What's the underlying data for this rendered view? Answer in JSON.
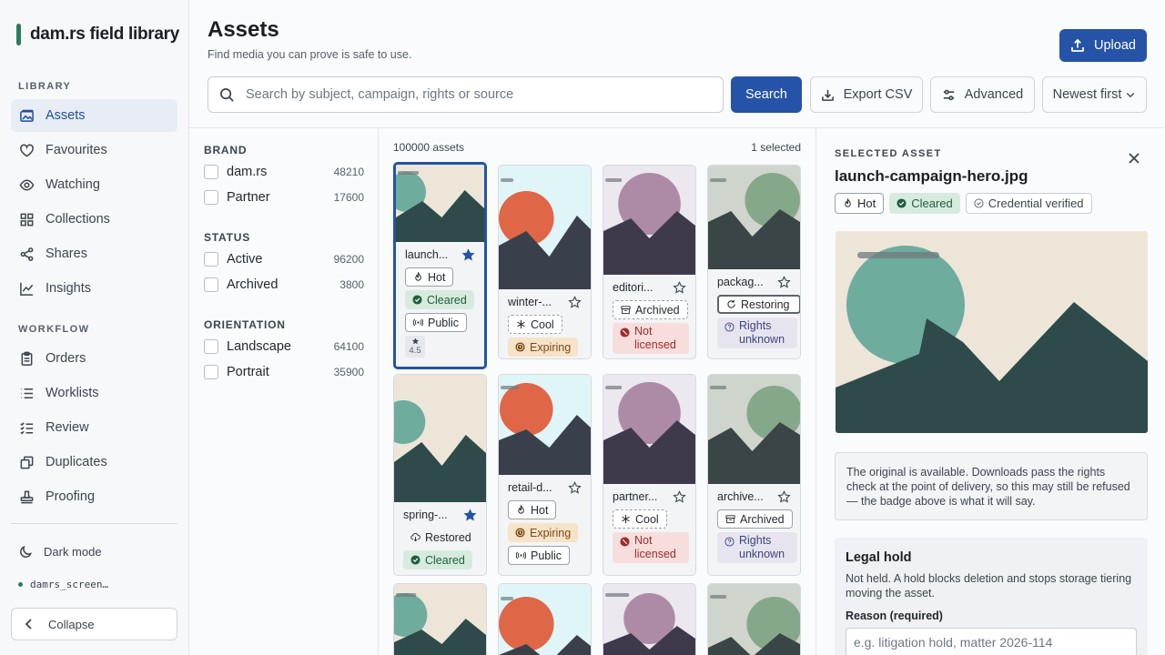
{
  "app": {
    "name": "dam.rs field library"
  },
  "sidebar": {
    "library_label": "LIBRARY",
    "library_items": [
      {
        "label": "Assets",
        "icon": "photo-icon"
      },
      {
        "label": "Favourites",
        "icon": "heart-icon"
      },
      {
        "label": "Watching",
        "icon": "eye-icon"
      },
      {
        "label": "Collections",
        "icon": "grid-icon"
      },
      {
        "label": "Shares",
        "icon": "share-icon"
      },
      {
        "label": "Insights",
        "icon": "chart-icon"
      }
    ],
    "workflow_label": "WORKFLOW",
    "workflow_items": [
      {
        "label": "Orders",
        "icon": "clipboard-icon"
      },
      {
        "label": "Worklists",
        "icon": "list-icon"
      },
      {
        "label": "Review",
        "icon": "checklist-icon"
      },
      {
        "label": "Duplicates",
        "icon": "copy-icon"
      },
      {
        "label": "Proofing",
        "icon": "stamp-icon"
      }
    ],
    "dark_mode": "Dark mode",
    "user": "damrs_screen…",
    "collapse": "Collapse"
  },
  "header": {
    "title": "Assets",
    "subtitle": "Find media you can prove is safe to use.",
    "upload": "Upload",
    "search_placeholder": "Search by subject, campaign, rights or source",
    "search_button": "Search",
    "export": "Export CSV",
    "advanced": "Advanced",
    "sort": "Newest first"
  },
  "filters": {
    "brand": {
      "label": "BRAND",
      "options": [
        {
          "label": "dam.rs",
          "count": "48210"
        },
        {
          "label": "Partner",
          "count": "17600"
        }
      ]
    },
    "status": {
      "label": "STATUS",
      "options": [
        {
          "label": "Active",
          "count": "96200"
        },
        {
          "label": "Archived",
          "count": "3800"
        }
      ]
    },
    "orientation": {
      "label": "ORIENTATION",
      "options": [
        {
          "label": "Landscape",
          "count": "64100"
        },
        {
          "label": "Portrait",
          "count": "35900"
        }
      ]
    }
  },
  "grid": {
    "count": "100000 assets",
    "selected": "1 selected",
    "cards": [
      {
        "title": "launch...",
        "starred": true,
        "tags": [
          {
            "text": "Hot"
          },
          {
            "text": "Cleared"
          },
          {
            "text": "Public"
          }
        ],
        "rating": "4.5"
      },
      {
        "title": "winter-...",
        "starred": false,
        "tags": [
          {
            "text": "Cool"
          },
          {
            "text": "Expiring"
          }
        ]
      },
      {
        "title": "editori...",
        "starred": false,
        "tags": [
          {
            "text": "Archived"
          },
          {
            "text": "Not licensed"
          }
        ]
      },
      {
        "title": "packag...",
        "starred": false,
        "tags": [
          {
            "text": "Restoring"
          },
          {
            "text": "Rights unknown"
          }
        ]
      },
      {
        "title": "spring-...",
        "starred": true,
        "tags": [
          {
            "text": "Restored"
          },
          {
            "text": "Cleared"
          }
        ]
      },
      {
        "title": "retail-d...",
        "starred": false,
        "tags": [
          {
            "text": "Hot"
          },
          {
            "text": "Expiring"
          },
          {
            "text": "Public"
          }
        ]
      },
      {
        "title": "partner...",
        "starred": false,
        "tags": [
          {
            "text": "Cool"
          },
          {
            "text": "Not licensed"
          }
        ]
      },
      {
        "title": "archive...",
        "starred": false,
        "tags": [
          {
            "text": "Archived"
          },
          {
            "text": "Rights unknown"
          }
        ]
      }
    ]
  },
  "detail": {
    "label": "SELECTED ASSET",
    "name": "launch-campaign-hero.jpg",
    "tags": [
      {
        "text": "Hot"
      },
      {
        "text": "Cleared"
      },
      {
        "text": "Credential verified"
      }
    ],
    "note": "The original is available. Downloads pass the rights check at the point of delivery, so this may still be refused — the badge above is what it will say.",
    "legal_hold": {
      "title": "Legal hold",
      "description": "Not held. A hold blocks deletion and stops storage tiering moving the asset.",
      "reason_label": "Reason (required)",
      "reason_placeholder": "e.g. litigation hold, matter 2026-114"
    }
  },
  "colors": {
    "accent": "#2453a8",
    "brand": "#2f7a5e",
    "cleared": "#d6ebde",
    "expiring": "#f7e3c9",
    "not_licensed": "#f8dddd",
    "rights_unknown": "#e6e5ef"
  }
}
